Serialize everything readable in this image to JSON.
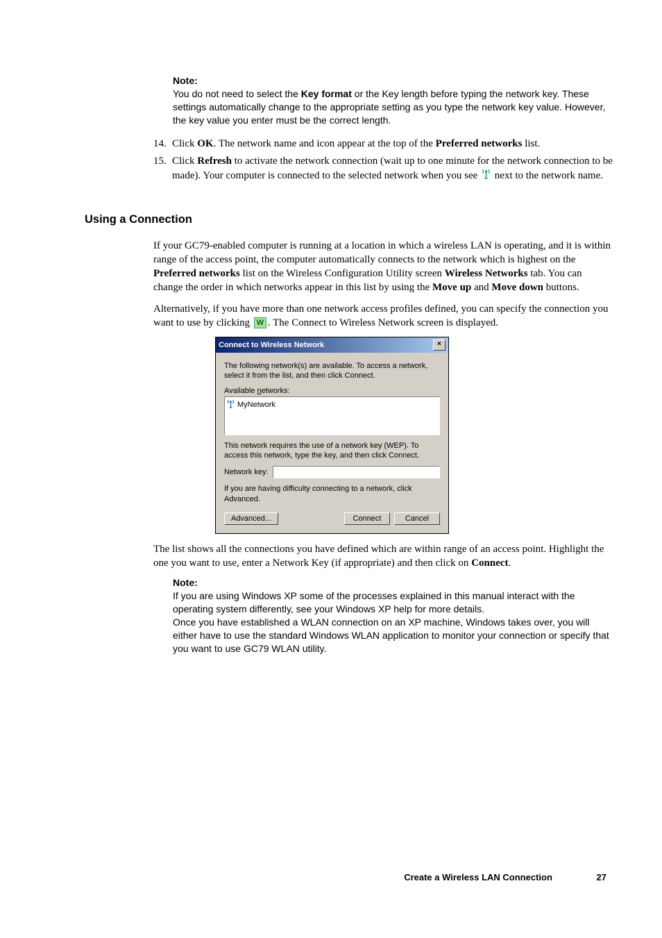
{
  "note1": {
    "heading": "Note:",
    "body_part1": "You do not need to select the ",
    "body_bold1": "Key format",
    "body_part2": " or the Key length before typing the network key. These settings automatically change to the appropriate setting as you type the network key value. However, the key value you enter must be the correct length."
  },
  "steps": {
    "s14_num": "14.",
    "s14_p1": "Click ",
    "s14_b1": "OK",
    "s14_p2": ". The network name and icon appear at the top of the ",
    "s14_b2": "Preferred networks",
    "s14_p3": " list.",
    "s15_num": "15.",
    "s15_p1": "Click ",
    "s15_b1": "Refresh",
    "s15_p2": " to activate the network connection (wait up to one minute for the network connection to be made). Your computer is connected to the selected network when you see ",
    "s15_p3": " next to the network name."
  },
  "section_heading": "Using a Connection",
  "para1_p1": "If your GC79-enabled computer is running at a location in which a wireless LAN is operating, and it is within range of the access point, the computer automatically connects to the network which is highest on the ",
  "para1_b1": "Preferred networks",
  "para1_p2": " list on the Wireless Configuration Utility screen ",
  "para1_b2": "Wireless Networks",
  "para1_p3": " tab. You can change the order in which networks appear in this list by using the ",
  "para1_b3": "Move up",
  "para1_p4": " and ",
  "para1_b4": "Move down",
  "para1_p5": " buttons.",
  "para2_p1": "Alternatively, if you have more than one network access profiles defined, you can specify the connection you want to use by clicking ",
  "para2_p2": ". The Connect to Wireless Network screen is displayed.",
  "dialog": {
    "title": "Connect to Wireless Network",
    "close_x": "×",
    "intro": "The following network(s) are available. To access a network, select it from the list, and then click Connect.",
    "available_label_pre": "Available ",
    "available_label_u": "n",
    "available_label_post": "etworks:",
    "list_item": "MyNetwork",
    "wep_text": "This network requires the use of a network key (WEP). To access this network, type the key, and then click Connect.",
    "key_label_pre": "Network ",
    "key_label_u": "k",
    "key_label_post": "ey:",
    "difficulty_text": "If you are having difficulty connecting to a network, click Advanced.",
    "btn_advanced_u": "A",
    "btn_advanced_post": "dvanced...",
    "btn_connect_u": "C",
    "btn_connect_post": "onnect",
    "btn_cancel": "Cancel"
  },
  "para3_p1": "The list shows all the connections you have defined which are within range of an access point. Highlight the one you want to use, enter a Network Key (if appropriate) and then click on ",
  "para3_b1": "Connect",
  "para3_p2": ".",
  "note2": {
    "heading": "Note:",
    "body": "If you are using Windows XP some of the processes explained in this manual interact with the operating system differently, see your Windows XP help for more details.\nOnce you have established a WLAN connection on an XP machine, Windows takes over, you will either have to use the standard Windows WLAN application to monitor your connection or specify that you want to use GC79 WLAN utility."
  },
  "footer_title": "Create a Wireless LAN Connection",
  "footer_page": "27",
  "icon_w_glyph": "W"
}
